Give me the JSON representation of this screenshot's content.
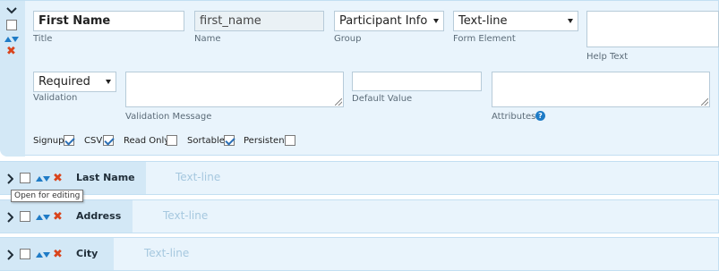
{
  "open_field": {
    "title_value": "First Name",
    "title_label": "Title",
    "name_value": "first_name",
    "name_label": "Name",
    "group_value": "Participant Info",
    "group_label": "Group",
    "form_element_value": "Text-line",
    "form_element_label": "Form Element",
    "help_text_label": "Help Text",
    "validation_value": "Required",
    "validation_label": "Validation",
    "validation_message_label": "Validation Message",
    "default_value_label": "Default Value",
    "attributes_label": "Attributes",
    "help_glyph": "?",
    "options": [
      {
        "label": "Signup",
        "checked": true
      },
      {
        "label": "CSV",
        "checked": true
      },
      {
        "label": "Read Only",
        "checked": false
      },
      {
        "label": "Sortable",
        "checked": true
      },
      {
        "label": "Persistent",
        "checked": false
      }
    ]
  },
  "rows": [
    {
      "name": "Last Name",
      "type": "Text-line"
    },
    {
      "name": "Address",
      "type": "Text-line"
    },
    {
      "name": "City",
      "type": "Text-line"
    }
  ],
  "tooltip": "Open for editing",
  "icons": {
    "close": "✖"
  },
  "colors": {
    "card_bg": "#e9f4fc",
    "gutter_bg": "#d3e8f6",
    "accent_blue": "#1e7bc6",
    "delete_red": "#d9441c"
  }
}
